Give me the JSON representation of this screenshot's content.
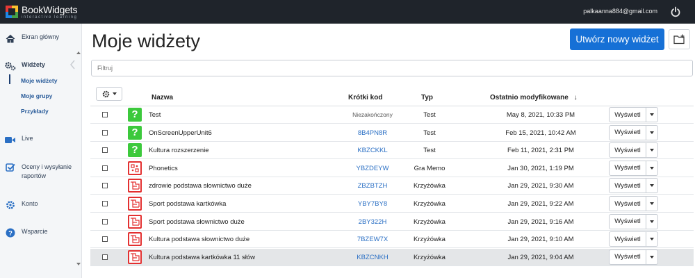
{
  "app": {
    "logo_name": "BookWidgets",
    "logo_tagline": "interactive learning",
    "user_email": "palkaanna884@gmail.com"
  },
  "sidebar": {
    "items": [
      {
        "label": "Ekran główny",
        "icon": "home-icon"
      },
      {
        "label": "Widżety",
        "icon": "gears-icon"
      },
      {
        "label": "Live",
        "icon": "video-camera-icon"
      },
      {
        "label": "Oceny i wysyłanie raportów",
        "icon": "checkbox-icon"
      },
      {
        "label": "Konto",
        "icon": "gear-icon"
      },
      {
        "label": "Wsparcie",
        "icon": "question-circle-icon"
      }
    ],
    "subitems": [
      "Moje widżety",
      "Moje grupy",
      "Przykłady"
    ]
  },
  "main": {
    "title": "Moje widżety",
    "new_button": "Utwórz nowy widżet",
    "filter_placeholder": "Filtruj",
    "columns": {
      "name": "Nazwa",
      "code": "Krótki kod",
      "type": "Typ",
      "modified": "Ostatnio modyfikowane",
      "sort_arrow": "↓"
    },
    "view_label": "Wyświetl",
    "rows": [
      {
        "name": "Test",
        "code": "Niezakończony",
        "type": "Test",
        "modified": "May 8, 2021, 10:33 PM",
        "icon": "test-question-icon"
      },
      {
        "name": "OnScreenUpperUnit6",
        "code": "8B4PN8R",
        "type": "Test",
        "modified": "Feb 15, 2021, 10:42 AM",
        "icon": "test-question-icon"
      },
      {
        "name": "Kultura rozszerzenie",
        "code": "KBZCKKL",
        "type": "Test",
        "modified": "Feb 11, 2021, 2:31 PM",
        "icon": "test-question-icon"
      },
      {
        "name": "Phonetics",
        "code": "YBZDEYW",
        "type": "Gra Memo",
        "modified": "Jan 30, 2021, 1:19 PM",
        "icon": "memo-game-icon"
      },
      {
        "name": "zdrowie podstawa słownictwo duże",
        "code": "ZBZBTZH",
        "type": "Krzyżówka",
        "modified": "Jan 29, 2021, 9:30 AM",
        "icon": "crossword-icon"
      },
      {
        "name": "Sport podstawa kartkówka",
        "code": "YBY7BY8",
        "type": "Krzyżówka",
        "modified": "Jan 29, 2021, 9:22 AM",
        "icon": "crossword-icon"
      },
      {
        "name": "Sport podstawa słownictwo duże",
        "code": "2BY322H",
        "type": "Krzyżówka",
        "modified": "Jan 29, 2021, 9:16 AM",
        "icon": "crossword-icon"
      },
      {
        "name": "Kultura podstawa słownictwo duże",
        "code": "7BZEW7X",
        "type": "Krzyżówka",
        "modified": "Jan 29, 2021, 9:10 AM",
        "icon": "crossword-icon"
      },
      {
        "name": "Kultura podstawa kartkówka 11 słów",
        "code": "KBZCNKH",
        "type": "Krzyżówka",
        "modified": "Jan 29, 2021, 9:04 AM",
        "icon": "crossword-icon"
      }
    ]
  },
  "colors": {
    "topbar": "#1f242b",
    "primary": "#1670d6",
    "test_icon": "#3cc93c",
    "game_icon": "#e33030",
    "link": "#2a6fc4"
  }
}
